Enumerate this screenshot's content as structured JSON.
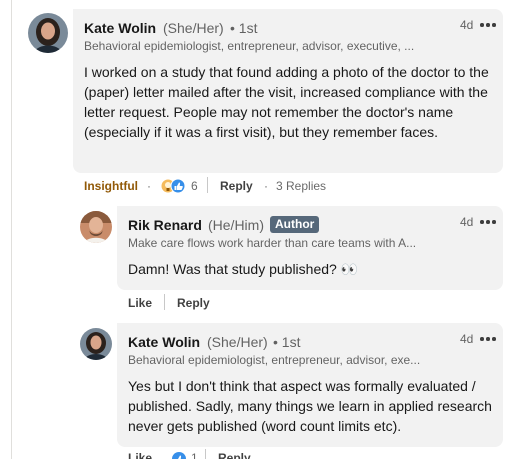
{
  "comments": [
    {
      "author": "Kate Wolin",
      "pronouns": "(She/Her)",
      "degree": "• 1st",
      "headline": "Behavioral epidemiologist, entrepreneur, advisor, executive, ...",
      "time": "4d",
      "text": "I worked on a study that found adding a photo of the doctor to the (paper) letter mailed after the visit, increased compliance with the letter request. People may not remember the doctor's name (especially if it was a first visit), but they remember faces.",
      "reaction_label": "Insightful",
      "reaction_count": "6",
      "reply_label": "Reply",
      "replies_count": "3 Replies"
    }
  ],
  "replies": [
    {
      "author": "Rik Renard",
      "pronouns": "(He/Him)",
      "badge": "Author",
      "headline": "Make care flows work harder than care teams with A...",
      "time": "4d",
      "text": "Damn! Was that study published? 👀",
      "like_label": "Like",
      "reply_label": "Reply"
    },
    {
      "author": "Kate Wolin",
      "pronouns": "(She/Her)",
      "degree": "• 1st",
      "headline": "Behavioral epidemiologist, entrepreneur, advisor, exe...",
      "time": "4d",
      "text": "Yes but I don't think that aspect was formally evaluated / published. Sadly, many things we learn in applied research never gets published (word count limits etc).",
      "like_label": "Like",
      "reaction_count": "1",
      "reply_label": "Reply"
    }
  ],
  "colors": {
    "bubble": "#f2f2f2",
    "author_badge": "#56687a",
    "insightful": "#915907",
    "like_blue": "#378fe9"
  }
}
